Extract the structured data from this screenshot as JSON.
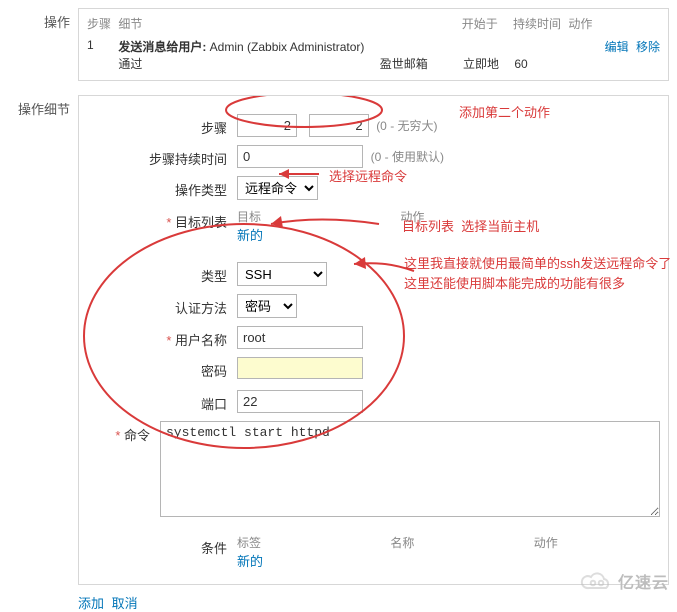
{
  "ops_section_label": "操作",
  "ops_header": {
    "step": "步骤",
    "detail": "细节",
    "start": "开始于",
    "duration": "持续时间",
    "action": "动作"
  },
  "ops_row1": {
    "idx": "1",
    "bold_prefix": "发送消息给用户:",
    "user": " Admin (Zabbix Administrator) ",
    "via_label": "通过",
    "via_value": " 盈世邮箱 ",
    "start": "立即地",
    "duration": "60",
    "edit": "编辑",
    "remove": "移除"
  },
  "details_section_label": "操作细节",
  "labels": {
    "step": "步骤",
    "duration": "步骤持续时间",
    "op_type": "操作类型",
    "target_list": "目标列表",
    "type": "类型",
    "auth": "认证方法",
    "username": "用户名称",
    "password": "密码",
    "port": "端口",
    "command": "命令",
    "conditions": "条件"
  },
  "values": {
    "step_from": "2",
    "step_to": "2",
    "step_inf": "(0 - 无穷大)",
    "duration": "0",
    "duration_hint": "(0 - 使用默认)",
    "op_type": "远程命令",
    "target_col_target": "目标",
    "target_col_action": "动作",
    "new_link": "新的",
    "type": "SSH",
    "auth": "密码",
    "username": "root",
    "port": "22",
    "command": "systemctl start httpd",
    "cond_col_label": "标签",
    "cond_col_name": "名称",
    "cond_col_action": "动作"
  },
  "annotations": {
    "a1": "添加第二个动作",
    "a2": "选择远程命令",
    "a3_left": "目标列表",
    "a3_right": "选择当前主机",
    "a4_line1": "这里我直接就使用最简单的ssh发送远程命令了",
    "a4_line2": "这里还能使用脚本能完成的功能有很多"
  },
  "footer": {
    "add": "添加",
    "cancel": "取消"
  },
  "watermark": "亿速云"
}
